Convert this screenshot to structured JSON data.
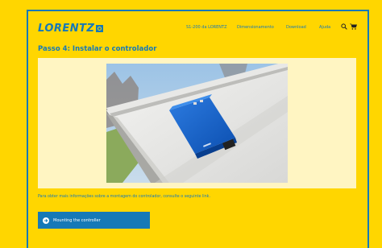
{
  "header": {
    "logo_text": "LORENTZ",
    "nav": [
      "S1-200 da LORENTZ",
      "Dimensionamento",
      "Download",
      "Ajuda"
    ],
    "icons": [
      "search-icon",
      "cart-icon"
    ]
  },
  "main": {
    "title": "Passo 4: Instalar o controlador",
    "info_text": "Para obter mais informações sobre a montagem do controlador, consulte o seguinte link.",
    "button_label": "Mounting the controller"
  },
  "colors": {
    "background": "#FFD600",
    "accent": "#1679B7",
    "card": "#FFF5C2"
  }
}
